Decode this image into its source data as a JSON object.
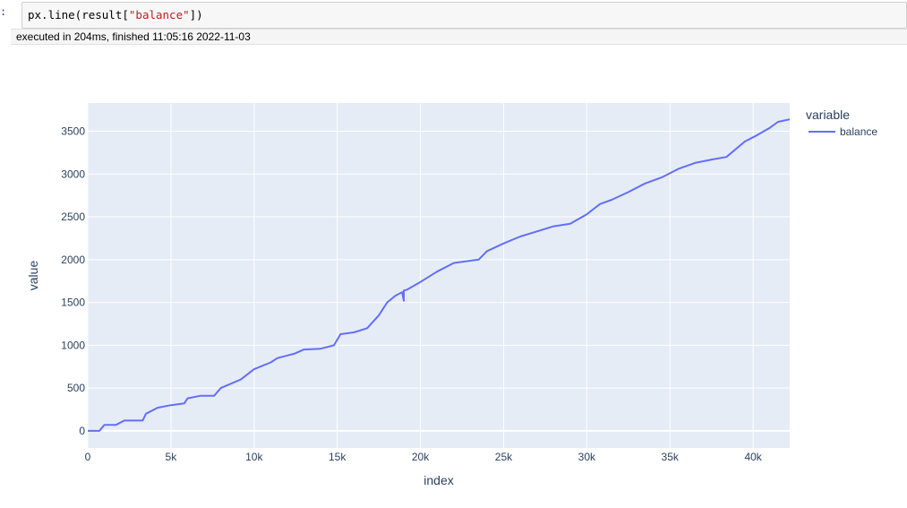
{
  "cell": {
    "prompt": ":",
    "code_prefix": "px.line(result[",
    "code_string": "\"balance\"",
    "code_suffix": "])",
    "exec_info": "executed in 204ms, finished 11:05:16 2022-11-03"
  },
  "chart_data": {
    "type": "line",
    "xlabel": "index",
    "ylabel": "value",
    "legend_title": "variable",
    "legend_position": "right",
    "xlim": [
      0,
      42200
    ],
    "ylim": [
      -200,
      3830
    ],
    "x_ticks": [
      0,
      5000,
      10000,
      15000,
      20000,
      25000,
      30000,
      35000,
      40000
    ],
    "x_tick_labels": [
      "0",
      "5k",
      "10k",
      "15k",
      "20k",
      "25k",
      "30k",
      "35k",
      "40k"
    ],
    "y_ticks": [
      0,
      500,
      1000,
      1500,
      2000,
      2500,
      3000,
      3500
    ],
    "y_tick_labels": [
      "0",
      "500",
      "1000",
      "1500",
      "2000",
      "2500",
      "3000",
      "3500"
    ],
    "grid": true,
    "colors": {
      "line": "#636efa",
      "plot_bg": "#e5ecf6",
      "grid": "#ffffff",
      "text": "#2a3f5f"
    },
    "series": [
      {
        "name": "balance",
        "x": [
          0,
          700,
          1000,
          1700,
          2200,
          3300,
          3500,
          4200,
          5000,
          5800,
          6000,
          6800,
          7600,
          8000,
          9200,
          10000,
          11000,
          11400,
          12000,
          12400,
          13000,
          14000,
          14800,
          15200,
          16000,
          16800,
          17500,
          18000,
          18500,
          18900,
          19000,
          19000,
          19200,
          20000,
          21000,
          22000,
          23500,
          24000,
          25000,
          26000,
          27000,
          28000,
          29000,
          30000,
          30800,
          31500,
          32500,
          33500,
          34500,
          35500,
          36500,
          37500,
          38400,
          39500,
          40200,
          41000,
          41500,
          42200
        ],
        "y": [
          0,
          0,
          70,
          70,
          120,
          120,
          200,
          270,
          300,
          320,
          380,
          410,
          410,
          500,
          600,
          720,
          800,
          850,
          880,
          900,
          950,
          960,
          1000,
          1130,
          1150,
          1200,
          1350,
          1500,
          1580,
          1620,
          1520,
          1640,
          1650,
          1740,
          1860,
          1960,
          2000,
          2100,
          2190,
          2270,
          2330,
          2390,
          2420,
          2530,
          2650,
          2700,
          2790,
          2890,
          2960,
          3060,
          3130,
          3170,
          3200,
          3380,
          3450,
          3540,
          3610,
          3640
        ]
      }
    ]
  }
}
